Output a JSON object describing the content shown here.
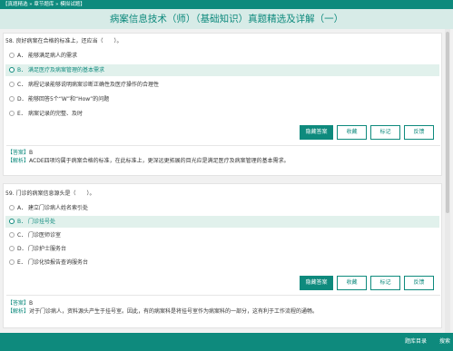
{
  "topbar": {
    "breadcrumb": "【真题精选 » 章节题库 » 模拟试题】"
  },
  "header": {
    "title": "病案信息技术（师）（基础知识）真题精选及详解（一）"
  },
  "questions": [
    {
      "stem": "58. 良好病案在合格的标准上，还应当（　　）。",
      "options": [
        {
          "letter": "A．",
          "text": "能够满足病人的需求"
        },
        {
          "letter": "B．",
          "text": "满足医疗及病案管理的基本需求"
        },
        {
          "letter": "C．",
          "text": "病程记录能够说明病案诊断正确性及医疗操作的合理性"
        },
        {
          "letter": "D．",
          "text": "能够回答5个“W”和“How”的问题"
        },
        {
          "letter": "E．",
          "text": "病案记录的完整、及时"
        }
      ],
      "selected": "B",
      "answer_tag": "【答案】",
      "answer": "B",
      "analysis_tag": "【解析】",
      "analysis": "ACDE四项均属于病案合格的标准，在此标准上，更深远更拓展的目光应是满足医疗及病案管理的基本需求。"
    },
    {
      "stem": "59. 门诊的病案信息源头是（　　）。",
      "options": [
        {
          "letter": "A．",
          "text": "建立门诊病人姓名索引处"
        },
        {
          "letter": "B．",
          "text": "门诊挂号处"
        },
        {
          "letter": "C．",
          "text": "门诊医师诊室"
        },
        {
          "letter": "D．",
          "text": "门诊护士服务台"
        },
        {
          "letter": "E．",
          "text": "门诊化验报告查询服务台"
        }
      ],
      "selected": "B",
      "answer_tag": "【答案】",
      "answer": "B",
      "analysis_tag": "【解析】",
      "analysis": "对于门诊病人，资料源头产生于挂号室。因此，有的病案科是将挂号室作为病案科的一部分，这有利于工作流程的通畅。"
    }
  ],
  "buttons": {
    "hide_answer": "隐藏答案",
    "favorite": "收藏",
    "mark": "标记",
    "feedback": "反馈"
  },
  "bottombar": {
    "catalog": "题库目录",
    "search": "搜索"
  },
  "colors": {
    "brand": "#0e8a7d",
    "selected_bg": "#e1f1ec"
  }
}
